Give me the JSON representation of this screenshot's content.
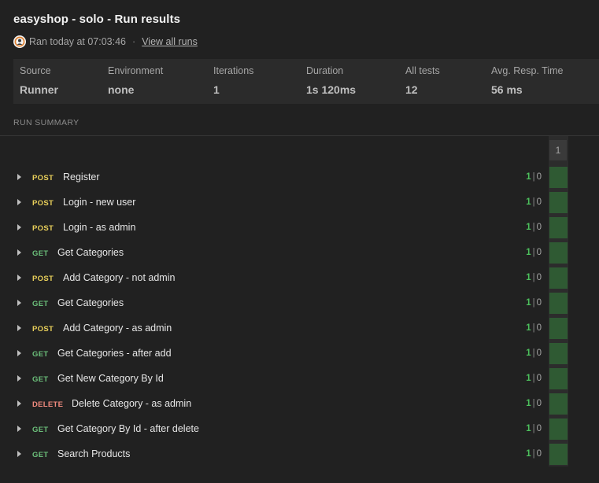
{
  "title": "easyshop - solo - Run results",
  "ran_text": "Ran today at 07:03:46",
  "separator": "·",
  "view_all_runs": "View all runs",
  "stats": [
    {
      "label": "Source",
      "value": "Runner"
    },
    {
      "label": "Environment",
      "value": "none"
    },
    {
      "label": "Iterations",
      "value": "1"
    },
    {
      "label": "Duration",
      "value": "1s 120ms"
    },
    {
      "label": "All tests",
      "value": "12"
    },
    {
      "label": "Avg. Resp. Time",
      "value": "56 ms"
    }
  ],
  "section_label": "RUN SUMMARY",
  "iteration_header": "1",
  "colors": {
    "get": "#6bbf7a",
    "post": "#e8cf5a",
    "delete": "#f08a7e",
    "pass_cell": "#2f5a33",
    "pass_count": "#4cbf5c"
  },
  "requests": [
    {
      "method": "POST",
      "name": "Register",
      "passed": "1",
      "failed": "0"
    },
    {
      "method": "POST",
      "name": "Login - new user",
      "passed": "1",
      "failed": "0"
    },
    {
      "method": "POST",
      "name": "Login - as admin",
      "passed": "1",
      "failed": "0"
    },
    {
      "method": "GET",
      "name": "Get Categories",
      "passed": "1",
      "failed": "0"
    },
    {
      "method": "POST",
      "name": "Add Category - not admin",
      "passed": "1",
      "failed": "0"
    },
    {
      "method": "GET",
      "name": "Get Categories",
      "passed": "1",
      "failed": "0"
    },
    {
      "method": "POST",
      "name": "Add Category - as admin",
      "passed": "1",
      "failed": "0"
    },
    {
      "method": "GET",
      "name": "Get Categories - after add",
      "passed": "1",
      "failed": "0"
    },
    {
      "method": "GET",
      "name": "Get New Category By Id",
      "passed": "1",
      "failed": "0"
    },
    {
      "method": "DELETE",
      "name": "Delete Category - as admin",
      "passed": "1",
      "failed": "0"
    },
    {
      "method": "GET",
      "name": "Get Category By Id - after delete",
      "passed": "1",
      "failed": "0"
    },
    {
      "method": "GET",
      "name": "Search Products",
      "passed": "1",
      "failed": "0"
    }
  ]
}
